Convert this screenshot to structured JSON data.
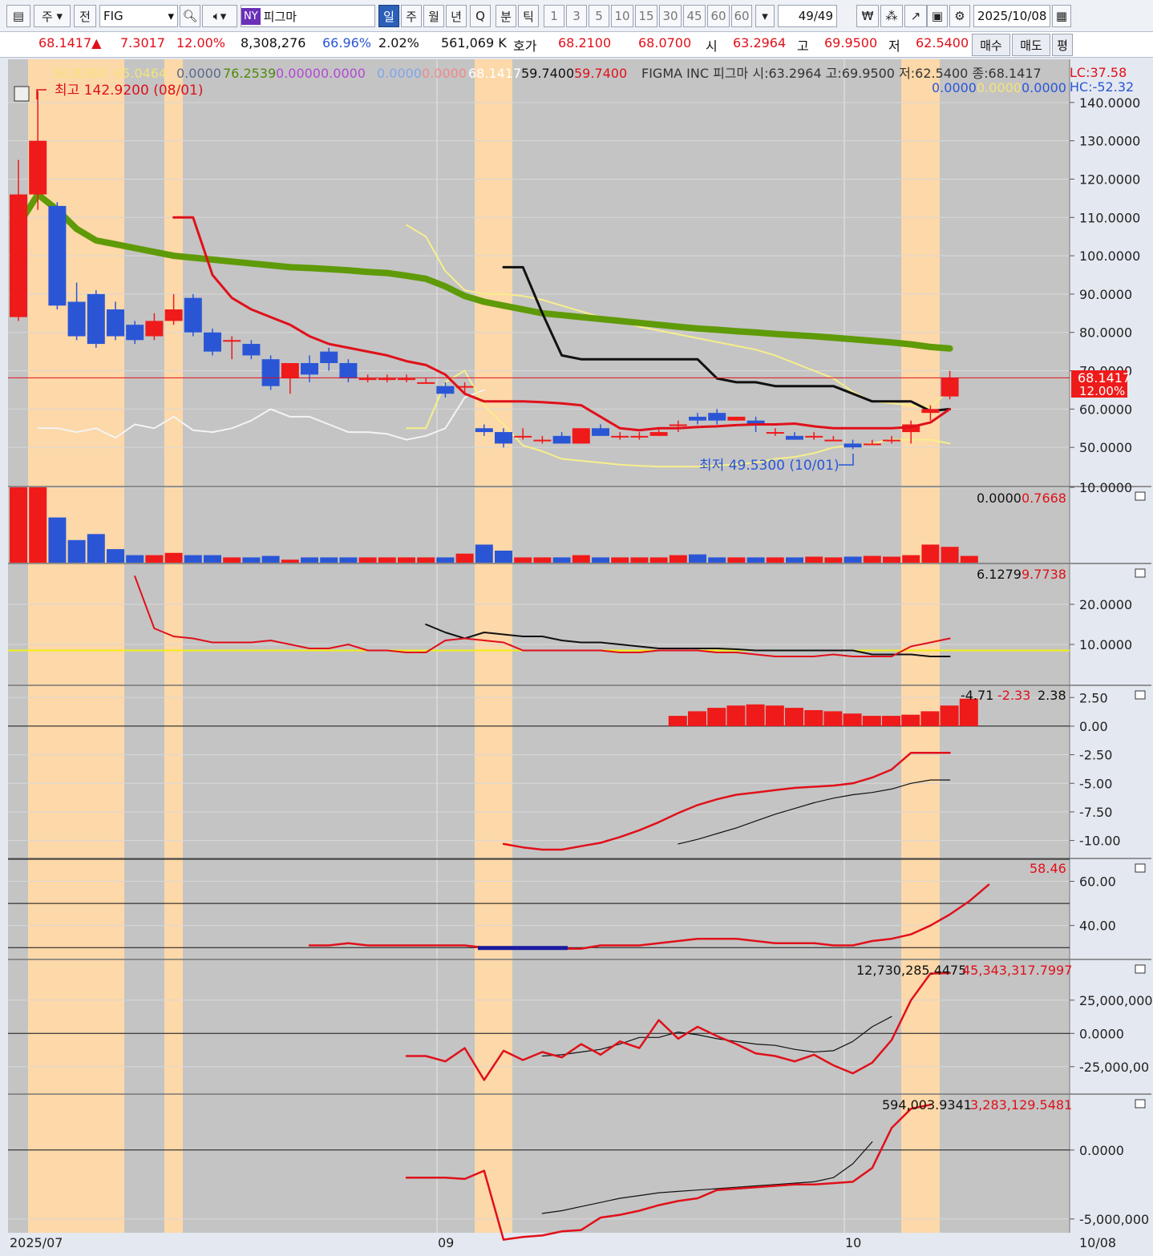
{
  "toolbar": {
    "market_toggle": "주",
    "prev_label": "전",
    "symbol": "FIG",
    "exchange_badge": "NY",
    "stock_name": "피그마",
    "periods": [
      "일",
      "주",
      "월",
      "년",
      "Q"
    ],
    "intraday": [
      "분",
      "틱"
    ],
    "intervals": [
      "1",
      "3",
      "5",
      "10",
      "15",
      "30",
      "45",
      "60",
      "60"
    ],
    "page_counter": "49/49",
    "date": "2025/10/08"
  },
  "quote": {
    "price": "68.1417",
    "arrow": "▲",
    "change": "7.3017",
    "change_pct": "12.00%",
    "volume": "8,308,276",
    "ratio": "66.96%",
    "turnover": "2.02%",
    "amount": "561,069 K",
    "bid_label": "호가",
    "ask_price": "68.2100",
    "bid_price": "68.0700",
    "open_label": "시",
    "open": "63.2964",
    "high_label": "고",
    "high": "69.9500",
    "low_label": "저",
    "low": "62.5400",
    "buy_label": "매수",
    "sell_label": "매도",
    "eval_label": "평"
  },
  "legend": {
    "ma1": "50.8360",
    "ma2": "65.0464",
    "v1": "0.0000",
    "v2": "76.2539",
    "v3": "0.0000",
    "v4": "0.0000",
    "v5": "0.0000",
    "v6": "0.0000",
    "v7": "68.1417",
    "v8": "59.7400",
    "v9": "59.7400",
    "title": "FIGMA INC  피그마 시:63.2964 고:69.9500 저:62.5400 종:68.1417",
    "lc": "LC:37.58",
    "hc": "HC:-52.32",
    "r1": "0.0000",
    "r2": "0.0000",
    "r3": "0.0000"
  },
  "annotations": {
    "high": "최고 142.9200 (08/01)",
    "low": "최저 49.5300 (10/01)",
    "price_tag": "68.1417",
    "price_tag_pct": "12.00%"
  },
  "panel_values": {
    "volume": [
      "0.0000",
      "0.7668"
    ],
    "ind2": [
      "6.1279",
      "9.7738"
    ],
    "macd": [
      "-4.71",
      "-2.33",
      "2.38"
    ],
    "rsi": [
      "58.46"
    ],
    "ind5": [
      "12,730,285.4475",
      "45,343,317.7997"
    ],
    "ind6": [
      "594,003.9341",
      "3,283,129.5481"
    ]
  },
  "x_axis": [
    "2025/07",
    "09",
    "10",
    "10/08"
  ],
  "colors": {
    "up": "#ef1a1a",
    "down": "#2a56d6",
    "ma_green": "#5f9a08",
    "highlight": "#fdd8a8",
    "bg": "#c4c4c4"
  },
  "chart_data": [
    {
      "type": "candlestick",
      "ylabel_ticks": [
        "140.0000",
        "130.0000",
        "120.0000",
        "110.0000",
        "100.0000",
        "90.0000",
        "80.0000",
        "70.0000",
        "60.0000",
        "50.0000"
      ],
      "ylim": [
        40,
        150
      ],
      "ohlc": [
        [
          84,
          125,
          83,
          116
        ],
        [
          116,
          143,
          112,
          130
        ],
        [
          113,
          114,
          86,
          87
        ],
        [
          88,
          93,
          78,
          79
        ],
        [
          90,
          91,
          76,
          77
        ],
        [
          86,
          88,
          78,
          79
        ],
        [
          82,
          83,
          77,
          78
        ],
        [
          79,
          85,
          78,
          83
        ],
        [
          83,
          90,
          82,
          86
        ],
        [
          89,
          90,
          79,
          80
        ],
        [
          80,
          81,
          74,
          75
        ],
        [
          78,
          79,
          73,
          78
        ],
        [
          77,
          78,
          73,
          74
        ],
        [
          73,
          74,
          65,
          66
        ],
        [
          68,
          69,
          64,
          72
        ],
        [
          72,
          74,
          67,
          69
        ],
        [
          75,
          76,
          70,
          72
        ],
        [
          72,
          73,
          67,
          68
        ],
        [
          68,
          69,
          67,
          68
        ],
        [
          68,
          69,
          67,
          68
        ],
        [
          68,
          69,
          67,
          68
        ],
        [
          67,
          68,
          67,
          67
        ],
        [
          66,
          67,
          63,
          64
        ],
        [
          66,
          67,
          64,
          66
        ],
        [
          55,
          56,
          53,
          54
        ],
        [
          54,
          55,
          50,
          51
        ],
        [
          53,
          55,
          52,
          53
        ],
        [
          52,
          53,
          51,
          52
        ],
        [
          53,
          54,
          51,
          51
        ],
        [
          51,
          55,
          51,
          55
        ],
        [
          55,
          56,
          53,
          53
        ],
        [
          53,
          54,
          52,
          53
        ],
        [
          53,
          54,
          52,
          53
        ],
        [
          53,
          55,
          53,
          54
        ],
        [
          56,
          57,
          54,
          56
        ],
        [
          58,
          59,
          56,
          57
        ],
        [
          59,
          60,
          56,
          57
        ],
        [
          57,
          58,
          57,
          58
        ],
        [
          57,
          58,
          54,
          56
        ],
        [
          54,
          55,
          53,
          54
        ],
        [
          53,
          54,
          52,
          52
        ],
        [
          53,
          54,
          52,
          53
        ],
        [
          52,
          53,
          52,
          52
        ],
        [
          51,
          52,
          49.53,
          50
        ],
        [
          51,
          52,
          51,
          51
        ],
        [
          52,
          53,
          51,
          52
        ],
        [
          54,
          57,
          51,
          56
        ],
        [
          59,
          61,
          57,
          60
        ],
        [
          63.2964,
          69.95,
          62.54,
          68.1417
        ]
      ],
      "ma_long": [
        108,
        116,
        112,
        107,
        104,
        103,
        102,
        101,
        100,
        99.5,
        99,
        98.5,
        98,
        97.5,
        97,
        96.8,
        96.5,
        96.2,
        95.8,
        95.5,
        94.8,
        94,
        92,
        89.5,
        88,
        87,
        86,
        85,
        84.5,
        84,
        83.5,
        83,
        82.5,
        82,
        81.5,
        81,
        80.7,
        80.3,
        80,
        79.6,
        79.3,
        79,
        78.6,
        78.2,
        77.8,
        77.4,
        76.9,
        76.2,
        75.8
      ],
      "price_line": [
        null,
        null,
        null,
        null,
        null,
        null,
        null,
        null,
        110,
        110,
        95,
        89,
        86,
        84,
        82,
        79,
        77,
        76,
        75,
        74,
        72.5,
        71.5,
        69,
        64,
        62,
        62,
        62,
        61.8,
        61.5,
        61,
        58,
        55,
        54.5,
        55,
        55,
        55.3,
        55.5,
        55.8,
        56,
        56,
        56.2,
        55.5,
        55,
        55,
        55,
        55,
        55.3,
        56.5,
        60
      ],
      "black_line": [
        null,
        null,
        null,
        null,
        null,
        null,
        null,
        null,
        null,
        null,
        null,
        null,
        null,
        null,
        null,
        null,
        null,
        null,
        null,
        null,
        null,
        null,
        null,
        null,
        null,
        97,
        97,
        85,
        74,
        73,
        73,
        73,
        73,
        73,
        73,
        73,
        68,
        67,
        67,
        66,
        66,
        66,
        66,
        64,
        62,
        62,
        62,
        59.5,
        60
      ],
      "yellow_upper": [
        null,
        null,
        null,
        null,
        null,
        null,
        null,
        null,
        null,
        null,
        null,
        null,
        null,
        null,
        null,
        null,
        null,
        null,
        null,
        null,
        108,
        105,
        96,
        91,
        90,
        90,
        89.5,
        88.5,
        87,
        85.5,
        84,
        83,
        81.5,
        80.5,
        79.5,
        78.5,
        77.5,
        76.5,
        75.5,
        74,
        72,
        70,
        68,
        64.5,
        62,
        61.5,
        61,
        60.5,
        65
      ],
      "yellow_lower": [
        null,
        null,
        null,
        null,
        null,
        null,
        null,
        null,
        null,
        null,
        null,
        null,
        null,
        null,
        null,
        null,
        null,
        null,
        null,
        null,
        55,
        55,
        67,
        70,
        61,
        56,
        50.5,
        49,
        47,
        46.5,
        46,
        45.5,
        45.2,
        45,
        45,
        45,
        45.3,
        45.6,
        46,
        47,
        47.5,
        48.5,
        50,
        50.5,
        51,
        52,
        52,
        52,
        51
      ],
      "white_line": [
        null,
        55,
        55,
        54,
        55,
        52.5,
        56,
        55,
        58,
        54.5,
        54,
        55,
        57,
        60,
        58,
        58,
        56,
        54,
        54,
        53.5,
        52,
        53,
        55,
        63,
        65,
        null,
        null,
        null,
        null,
        null,
        null,
        null,
        null,
        null,
        null,
        null,
        null,
        null,
        null,
        null,
        null,
        null,
        null,
        null,
        null,
        null,
        null,
        null,
        null
      ]
    },
    {
      "type": "bar",
      "name": "volume",
      "ylabel_ticks": [
        "10.0000"
      ],
      "ylim": [
        0,
        10
      ],
      "values": [
        10,
        10,
        6,
        3,
        3.8,
        1.8,
        1,
        1,
        1.3,
        1,
        1,
        0.7,
        0.7,
        0.9,
        0.4,
        0.7,
        0.7,
        0.7,
        0.7,
        0.7,
        0.7,
        0.7,
        0.7,
        1.2,
        2.4,
        1.6,
        0.7,
        0.7,
        0.7,
        1,
        0.7,
        0.7,
        0.7,
        0.7,
        1,
        1.1,
        0.7,
        0.7,
        0.7,
        0.7,
        0.7,
        0.8,
        0.7,
        0.8,
        0.9,
        0.8,
        1,
        2.4,
        2.1,
        0.9
      ]
    },
    {
      "type": "line",
      "name": "indicator-2",
      "ylabel_ticks": [
        "20.0000",
        "10.0000"
      ],
      "ylim": [
        0,
        30
      ],
      "red": [
        null,
        null,
        null,
        null,
        null,
        null,
        27,
        14,
        12,
        11.5,
        10.5,
        10.5,
        10.5,
        11,
        10,
        9,
        9,
        10,
        8.5,
        8.5,
        8,
        8,
        11,
        11.5,
        11,
        10.5,
        8.5,
        8.5,
        8.5,
        8.5,
        8.5,
        8,
        8,
        8.5,
        8.5,
        8.5,
        8,
        8,
        7.5,
        7,
        7,
        7,
        7.5,
        7,
        7,
        7,
        9.5,
        10.5,
        11.5
      ],
      "black": [
        null,
        null,
        null,
        null,
        null,
        null,
        null,
        null,
        null,
        null,
        null,
        null,
        null,
        null,
        null,
        null,
        null,
        null,
        null,
        null,
        null,
        15,
        13,
        11.5,
        13,
        12.5,
        12,
        12,
        11,
        10.5,
        10.5,
        10,
        9.5,
        9,
        9,
        9,
        9,
        8.8,
        8.5,
        8.5,
        8.5,
        8.5,
        8.5,
        8.5,
        7.5,
        7.5,
        7.5,
        7,
        7
      ],
      "level": 8.5
    },
    {
      "type": "bar+line",
      "name": "macd",
      "ylabel_ticks": [
        "2.50",
        "0.00",
        "-2.50",
        "-5.00",
        "-7.50",
        "-10.00"
      ],
      "ylim": [
        -11.5,
        3.5
      ],
      "hist": [
        null,
        null,
        null,
        null,
        null,
        null,
        null,
        null,
        null,
        null,
        null,
        null,
        null,
        null,
        null,
        null,
        null,
        null,
        null,
        null,
        null,
        null,
        null,
        null,
        null,
        null,
        null,
        null,
        null,
        null,
        null,
        null,
        null,
        null,
        0.9,
        1.3,
        1.6,
        1.8,
        1.9,
        1.8,
        1.6,
        1.4,
        1.3,
        1.1,
        0.9,
        0.9,
        1.0,
        1.3,
        1.8,
        2.4
      ],
      "macd": [
        null,
        null,
        null,
        null,
        null,
        null,
        null,
        null,
        null,
        null,
        null,
        null,
        null,
        null,
        null,
        null,
        null,
        null,
        null,
        null,
        null,
        null,
        null,
        null,
        null,
        -10.3,
        -10.6,
        -10.8,
        -10.8,
        -10.5,
        -10.2,
        -9.7,
        -9.1,
        -8.4,
        -7.6,
        -6.9,
        -6.4,
        -6.0,
        -5.8,
        -5.6,
        -5.4,
        -5.3,
        -5.2,
        -5.0,
        -4.5,
        -3.8,
        -2.33,
        -2.33,
        -2.33
      ],
      "signal": [
        null,
        null,
        null,
        null,
        null,
        null,
        null,
        null,
        null,
        null,
        null,
        null,
        null,
        null,
        null,
        null,
        null,
        null,
        null,
        null,
        null,
        null,
        null,
        null,
        null,
        null,
        null,
        null,
        null,
        null,
        null,
        null,
        null,
        null,
        -10.3,
        -9.9,
        -9.4,
        -8.9,
        -8.3,
        -7.7,
        -7.2,
        -6.7,
        -6.3,
        -6.0,
        -5.8,
        -5.5,
        -5.0,
        -4.71,
        -4.71
      ]
    },
    {
      "type": "line",
      "name": "rsi",
      "ylabel_ticks": [
        "60.00",
        "40.00"
      ],
      "ylim": [
        25,
        70
      ],
      "levels": [
        70,
        50,
        30
      ],
      "values": [
        null,
        null,
        null,
        null,
        null,
        null,
        null,
        null,
        null,
        null,
        null,
        null,
        null,
        null,
        null,
        31,
        31,
        32,
        31,
        31,
        31,
        31,
        31,
        31,
        30,
        29.5,
        29.5,
        29.5,
        29.5,
        29.5,
        31,
        31,
        31,
        32,
        33,
        34,
        34,
        34,
        33,
        32,
        32,
        32,
        31,
        31,
        33,
        34,
        36,
        40,
        45,
        51,
        58.46
      ]
    },
    {
      "type": "line",
      "name": "indicator-5",
      "ylabel_ticks": [
        "25,000,000",
        "0.0000",
        "-25,000,00"
      ],
      "ylim": [
        -45000000,
        55000000
      ],
      "red": [
        null,
        null,
        null,
        null,
        null,
        null,
        null,
        null,
        null,
        null,
        null,
        null,
        null,
        null,
        null,
        null,
        null,
        null,
        null,
        null,
        -17000000,
        -17000000,
        -21000000,
        -11000000,
        -35000000,
        -13000000,
        -20000000,
        -14000000,
        -18000000,
        -8000000,
        -16000000,
        -6000000,
        -11000000,
        10000000,
        -4000000,
        5000000,
        -2000000,
        -8000000,
        -15000000,
        -17000000,
        -21000000,
        -16000000,
        -24000000,
        -30000000,
        -22000000,
        -5000000,
        25000000,
        45000000,
        45343317
      ],
      "black": [
        null,
        null,
        null,
        null,
        null,
        null,
        null,
        null,
        null,
        null,
        null,
        null,
        null,
        null,
        null,
        null,
        null,
        null,
        null,
        null,
        null,
        null,
        null,
        null,
        null,
        null,
        null,
        -17000000,
        -16000000,
        -14000000,
        -12000000,
        -8000000,
        -3000000,
        -3000000,
        1000000,
        -1000000,
        -4000000,
        -6000000,
        -8000000,
        -9000000,
        -12000000,
        -14000000,
        -13000000,
        -6000000,
        5000000,
        12730285
      ]
    },
    {
      "type": "line",
      "name": "indicator-6",
      "ylabel_ticks": [
        "0.0000",
        "-5,000,000"
      ],
      "ylim": [
        -6000000,
        4000000
      ],
      "red": [
        null,
        null,
        null,
        null,
        null,
        null,
        null,
        null,
        null,
        null,
        null,
        null,
        null,
        null,
        null,
        null,
        null,
        null,
        null,
        null,
        -2000000,
        -2000000,
        -2000000,
        -2100000,
        -1500000,
        -6500000,
        -6300000,
        -6200000,
        -5900000,
        -5800000,
        -4900000,
        -4700000,
        -4400000,
        -4000000,
        -3700000,
        -3500000,
        -2900000,
        -2800000,
        -2700000,
        -2600000,
        -2500000,
        -2500000,
        -2400000,
        -2300000,
        -1300000,
        1600000,
        3000000,
        3283129
      ],
      "black": [
        null,
        null,
        null,
        null,
        null,
        null,
        null,
        null,
        null,
        null,
        null,
        null,
        null,
        null,
        null,
        null,
        null,
        null,
        null,
        null,
        null,
        null,
        null,
        null,
        null,
        null,
        null,
        -4600000,
        -4400000,
        -4100000,
        -3800000,
        -3500000,
        -3300000,
        -3100000,
        -3000000,
        -2900000,
        -2800000,
        -2700000,
        -2600000,
        -2500000,
        -2400000,
        -2300000,
        -2000000,
        -1000000,
        594003
      ]
    }
  ]
}
